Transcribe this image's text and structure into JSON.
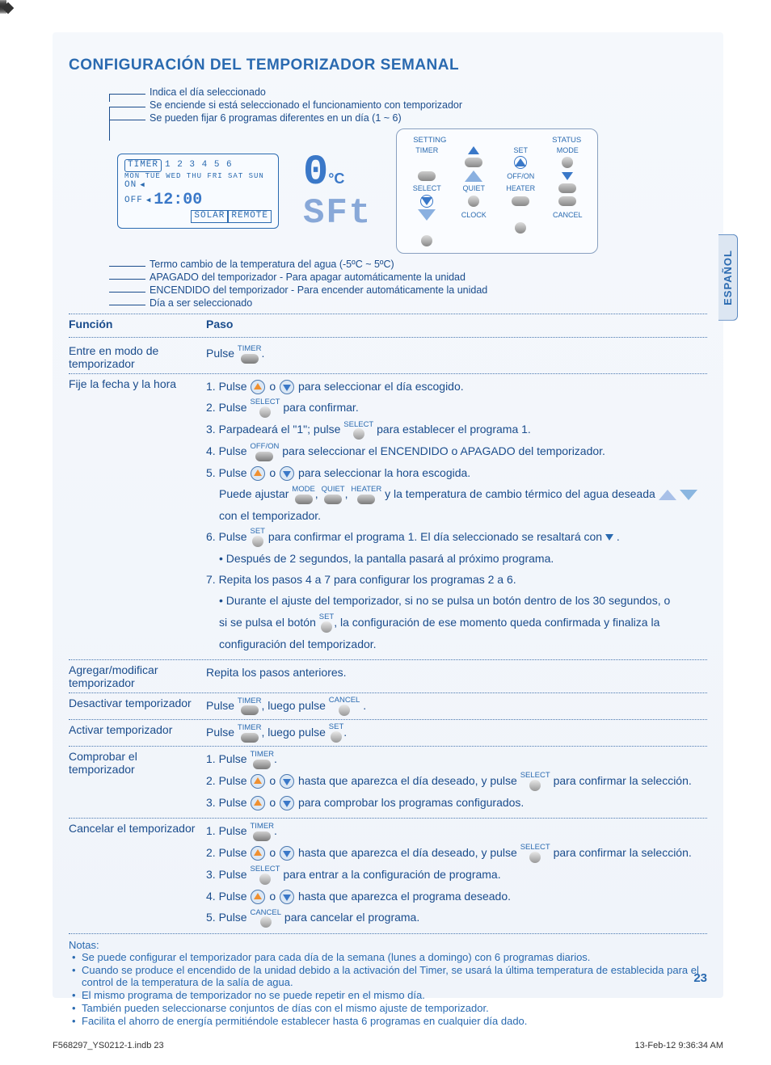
{
  "title": "CONFIGURACIÓN DEL TEMPORIZADOR SEMANAL",
  "lang_tab": "ESPAÑOL",
  "callouts_top": {
    "c1": "Indica el día seleccionado",
    "c2": "Se enciende si está seleccionado el funcionamiento con temporizador",
    "c3": "Se pueden fijar 6 programas diferentes en un día (1 ~ 6)"
  },
  "lcd": {
    "timer": "TIMER",
    "progs": "1 2 3 4 5 6",
    "days": "MON TUE WED THU FRI SAT SUN",
    "on": "ON",
    "off": "OFF",
    "time": "12:00",
    "solar": "SOLAR",
    "remote": "REMOTE"
  },
  "seg_zero": "0",
  "seg_unit": "°C",
  "seg_sft": "SFt",
  "panel": {
    "hdr_setting": "SETTING",
    "hdr_status": "STATUS",
    "timer": "TIMER",
    "set": "SET",
    "mode": "MODE",
    "offon": "OFF/ON",
    "select": "SELECT",
    "quiet": "QUIET",
    "heater": "HEATER",
    "clock": "CLOCK",
    "cancel": "CANCEL"
  },
  "callouts_bottom": {
    "b1": "Termo cambio de la temperatura del agua (-5ºC ~ 5ºC)",
    "b2": "APAGADO del temporizador - Para apagar automáticamente la unidad",
    "b3": "ENCENDIDO del temporizador - Para encender automáticamente la unidad",
    "b4": "Día a ser seleccionado"
  },
  "tbl_hdr": {
    "func": "Función",
    "paso": "Paso"
  },
  "rows": {
    "r1_func": "Entre en modo de temporizador",
    "r1_s": "Pulse",
    "lbl_timer": "TIMER",
    "r2_func": "Fije la fecha y la hora",
    "r2_1a": "1. Pulse",
    "r2_1b": "o",
    "r2_1c": "para seleccionar el día escogido.",
    "lbl_select": "SELECT",
    "r2_2a": "2. Pulse",
    "r2_2b": "para confirmar.",
    "r2_3a": "3. Parpadeará el \"1\"; pulse",
    "r2_3b": "para establecer el programa 1.",
    "lbl_offon": "OFF/ON",
    "r2_4a": "4. Pulse",
    "r2_4b": "para seleccionar el ENCENDIDO o APAGADO del temporizador.",
    "r2_5a": "5. Pulse",
    "r2_5b": "o",
    "r2_5c": "para seleccionar la hora escogida.",
    "lbl_mode": "MODE",
    "lbl_quiet": "QUIET",
    "lbl_heater": "HEATER",
    "r2_5d": "Puede ajustar",
    "r2_5e": ",",
    "r2_5f": ",",
    "r2_5g": "y la temperatura de cambio térmico del agua deseada",
    "r2_5h": "con el temporizador.",
    "lbl_set": "SET",
    "r2_6a": "6. Pulse",
    "r2_6b": "para confirmar el programa 1. El día seleccionado se resaltará con",
    "r2_6c": ".",
    "r2_6d": "• Después de 2 segundos, la pantalla pasará al próximo programa.",
    "r2_7": "7. Repita los pasos 4 a 7 para configurar los programas 2 a 6.",
    "r2_7b1": "• Durante el ajuste del temporizador, si no se pulsa un botón dentro de los 30 segundos, o",
    "r2_7b2a": "si se pulsa el botón",
    "r2_7b2b": ", la configuración de ese momento queda confirmada y finaliza la",
    "r2_7b3": "configuración del temporizador.",
    "r3_func": "Agregar/modificar temporizador",
    "r3_s": "Repita los pasos anteriores.",
    "r4_func": "Desactivar temporizador",
    "r4_a": "Pulse",
    "r4_b": ", luego pulse",
    "lbl_cancel": "CANCEL",
    "r5_func": "Activar temporizador",
    "r5_a": "Pulse",
    "r5_b": ", luego pulse",
    "r6_func": "Comprobar el temporizador",
    "r6_1": "1. Pulse",
    "r6_2a": "2. Pulse",
    "r6_2b": "o",
    "r6_2c": "hasta que aparezca el día deseado, y pulse",
    "r6_2d": "para confirmar la selección.",
    "r6_3a": "3. Pulse",
    "r6_3b": "o",
    "r6_3c": "para comprobar los programas configurados.",
    "r7_func": "Cancelar el temporizador",
    "r7_1": "1. Pulse",
    "r7_2a": "2. Pulse",
    "r7_2b": "o",
    "r7_2c": "hasta que aparezca el día deseado, y pulse",
    "r7_2d": "para confirmar la selección.",
    "r7_3a": "3. Pulse",
    "r7_3b": "para entrar a la configuración de programa.",
    "r7_4a": "4. Pulse",
    "r7_4b": "o",
    "r7_4c": "hasta que aparezca el programa deseado.",
    "r7_5a": "5. Pulse",
    "r7_5b": "para cancelar el programa."
  },
  "dot": ".",
  "notas_title": "Notas:",
  "notas": {
    "n1": "Se puede configurar el temporizador para cada día de la semana (lunes a domingo) con 6 programas diarios.",
    "n2": "Cuando se produce el encendido de la unidad debido a la activación del Timer, se usará la última temperatura de establecida para el control de la temperatura de la salía de agua.",
    "n3": "El mismo programa de temporizador no se puede repetir en el mismo día.",
    "n4": "También pueden seleccionarse conjuntos de días con el mismo ajuste de temporizador.",
    "n5": "Facilita el ahorro de energía permitiéndole establecer hasta 6 programas en cualquier día dado."
  },
  "page_num": "23",
  "footer_left": "F568297_YS0212-1.indb   23",
  "footer_right": "13-Feb-12   9:36:34 AM"
}
